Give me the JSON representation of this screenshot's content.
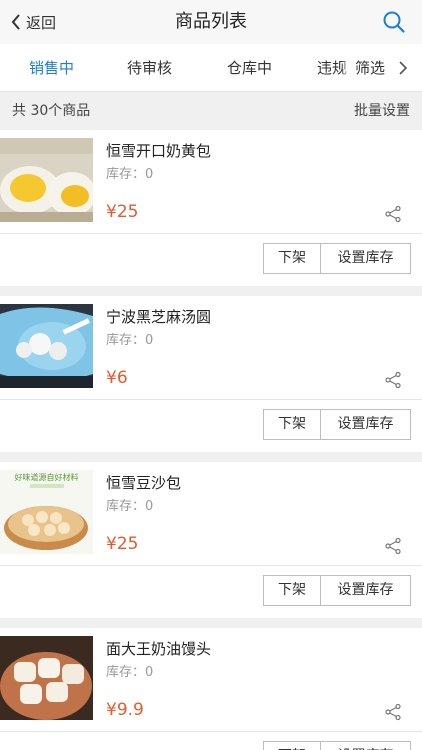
{
  "navbar": {
    "back_label": "返回",
    "title": "商品列表"
  },
  "tabs": [
    {
      "label": "销售中",
      "active": true
    },
    {
      "label": "待审核"
    },
    {
      "label": "仓库中"
    },
    {
      "label": "违规"
    },
    {
      "label": "筛选"
    }
  ],
  "summary": {
    "count": "共 30个商品",
    "batch": "批量设置"
  },
  "products": [
    {
      "name": "恒雪开口奶黄包",
      "stock": "库存：0",
      "price": "¥25",
      "off_label": "下架",
      "stock_label": "设置库存"
    },
    {
      "name": "宁波黑芝麻汤圆",
      "stock": "库存：0",
      "price": "¥6",
      "off_label": "下架",
      "stock_label": "设置库存"
    },
    {
      "name": "恒雪豆沙包",
      "stock": "库存：0",
      "price": "¥25",
      "off_label": "下架",
      "stock_label": "设置库存",
      "image_text": "好味道源自好材料"
    },
    {
      "name": "面大王奶油馒头",
      "stock": "库存：0",
      "price": "¥9.9",
      "off_label": "下架",
      "stock_label": "设置库存"
    }
  ],
  "colors": {
    "accent": "#1a7ed6",
    "price": "#e85a2b"
  }
}
